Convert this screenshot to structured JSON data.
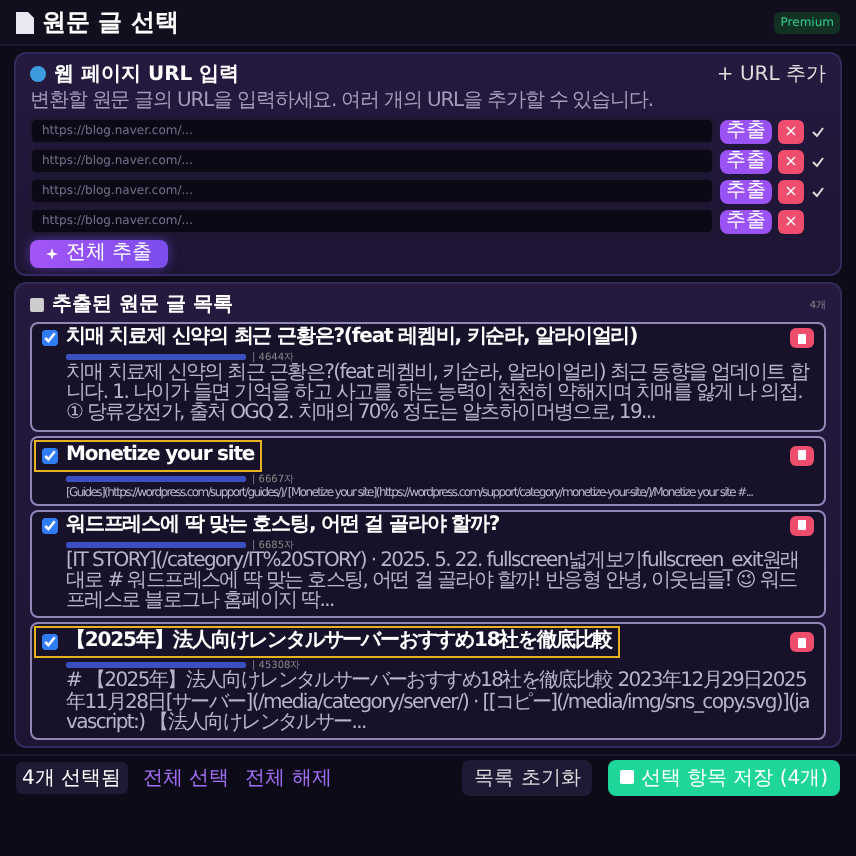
{
  "header": {
    "title": "원문 글 선택",
    "badge": "Premium"
  },
  "url_section": {
    "title": "웹 페이지 URL 입력",
    "add_button": "+ URL 추가",
    "description": "변환할 원문 글의 URL을 입력하세요. 여러 개의 URL을 추가할 수 있습니다.",
    "rows": [
      {
        "placeholder": "https://blog.naver.com/...",
        "extract": "추출",
        "remove": "×",
        "done": true
      },
      {
        "placeholder": "https://blog.naver.com/...",
        "extract": "추출",
        "remove": "×",
        "done": true
      },
      {
        "placeholder": "https://blog.naver.com/...",
        "extract": "추출",
        "remove": "×",
        "done": true
      },
      {
        "placeholder": "https://blog.naver.com/...",
        "extract": "추출",
        "remove": "×",
        "done": false
      }
    ],
    "extract_all": "전체 추출"
  },
  "list_section": {
    "title": "추출된 원문 글 목록",
    "count": "4개",
    "items": [
      {
        "checked": true,
        "highlighted": false,
        "title": "치매 치료제 신약의 최근 근황은?(feat 레켐비, 키순라, 알라이얼리)",
        "length": "| 4644자",
        "excerpt": "치매 치료제 신약의 최근 근황은?(feat 레켐비, 키순라, 알라이얼리) 최근 동향을 업데이트 합니다. 1. 나이가 들면 기억을 하고 사고를 하는 능력이 천천히 약해지며 치매를 앓게 나 의접. ① 당류강전가, 출처 OGQ 2. 치매의 70% 정도는 알츠하이머병으로, 19..."
      },
      {
        "checked": true,
        "highlighted": true,
        "title": "Monetize your site",
        "length": "| 6667자",
        "excerpt": "[Guides](https://wordpress.com/support/guides/)/ [Monetize your site](https://wordpress.com/support/category/monetize-your-site/)/Monetize your site #..."
      },
      {
        "checked": true,
        "highlighted": false,
        "title": "워드프레스에 딱 맞는 호스팅, 어떤 걸 골라야 할까?",
        "length": "| 6685자",
        "excerpt": "[IT STORY](/category/IT%20STORY) · 2025. 5. 22. fullscreen넓게보기fullscreen_exit원래대로 # 워드프레스에 딱 맞는 호스팅, 어떤 걸 골라야 할까! 반응형 안녕, 이웃님들! 😉 워드프레스로 블로그나 홈페이지 딱..."
      },
      {
        "checked": true,
        "highlighted": true,
        "title": "【2025年】法人向けレンタルサーバーおすすめ18社を徹底比較",
        "length": "| 45308자",
        "excerpt": "# 【2025年】法人向けレンタルサーバーおすすめ18社を徹底比較 2023年12月29日2025年11月28日[サーバー](/media/category/server/) · [[コピー](/media/img/sns_copy.svg)](javascript:) 【法人向けレンタルサー..."
      }
    ]
  },
  "footer": {
    "selected_count": "4개 선택됨",
    "select_all": "전체 선택",
    "deselect_all": "전체 해제",
    "reset": "목록 초기화",
    "save": "선택 항목 저장 (4개)"
  }
}
